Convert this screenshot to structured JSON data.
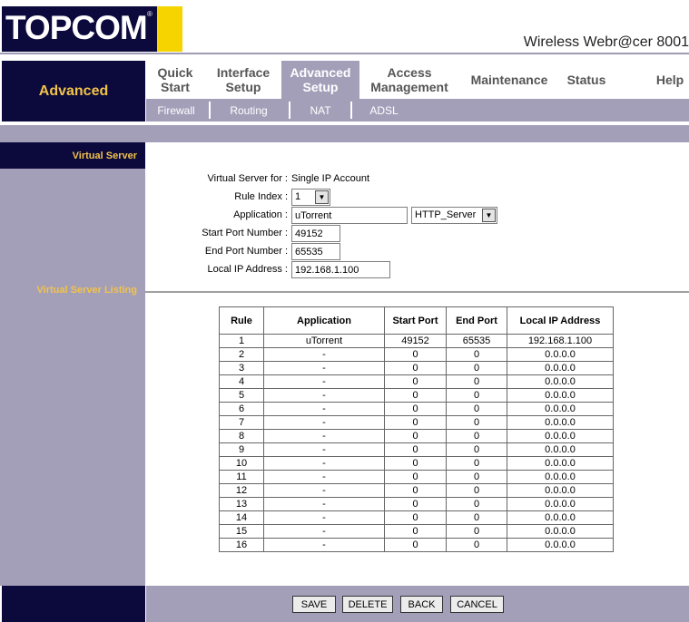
{
  "brand": {
    "logo_text": "TOPCOM",
    "reg_mark": "®",
    "product": "Wireless Webr@cer 8001"
  },
  "section": "Advanced",
  "nav": {
    "main": [
      {
        "label": "Quick Start"
      },
      {
        "label": "Interface Setup"
      },
      {
        "label": "Advanced Setup"
      },
      {
        "label": "Access Management"
      },
      {
        "label": "Maintenance"
      },
      {
        "label": "Status"
      },
      {
        "label": "Help"
      }
    ],
    "sub": [
      {
        "label": "Firewall"
      },
      {
        "label": "Routing"
      },
      {
        "label": "NAT"
      },
      {
        "label": "ADSL"
      }
    ]
  },
  "sidebar": {
    "virtual_server": "Virtual Server",
    "virtual_server_listing": "Virtual Server Listing"
  },
  "form": {
    "vs_for_label": "Virtual Server for :",
    "vs_for_value": "Single IP Account",
    "rule_index_label": "Rule Index :",
    "rule_index_value": "1",
    "application_label": "Application :",
    "application_value": "uTorrent",
    "application_select": "HTTP_Server",
    "start_port_label": "Start Port Number :",
    "start_port_value": "49152",
    "end_port_label": "End Port Number :",
    "end_port_value": "65535",
    "local_ip_label": "Local IP Address :",
    "local_ip_value": "192.168.1.100"
  },
  "table": {
    "headers": [
      "Rule",
      "Application",
      "Start Port",
      "End Port",
      "Local IP Address"
    ],
    "rows": [
      [
        "1",
        "uTorrent",
        "49152",
        "65535",
        "192.168.1.100"
      ],
      [
        "2",
        "-",
        "0",
        "0",
        "0.0.0.0"
      ],
      [
        "3",
        "-",
        "0",
        "0",
        "0.0.0.0"
      ],
      [
        "4",
        "-",
        "0",
        "0",
        "0.0.0.0"
      ],
      [
        "5",
        "-",
        "0",
        "0",
        "0.0.0.0"
      ],
      [
        "6",
        "-",
        "0",
        "0",
        "0.0.0.0"
      ],
      [
        "7",
        "-",
        "0",
        "0",
        "0.0.0.0"
      ],
      [
        "8",
        "-",
        "0",
        "0",
        "0.0.0.0"
      ],
      [
        "9",
        "-",
        "0",
        "0",
        "0.0.0.0"
      ],
      [
        "10",
        "-",
        "0",
        "0",
        "0.0.0.0"
      ],
      [
        "11",
        "-",
        "0",
        "0",
        "0.0.0.0"
      ],
      [
        "12",
        "-",
        "0",
        "0",
        "0.0.0.0"
      ],
      [
        "13",
        "-",
        "0",
        "0",
        "0.0.0.0"
      ],
      [
        "14",
        "-",
        "0",
        "0",
        "0.0.0.0"
      ],
      [
        "15",
        "-",
        "0",
        "0",
        "0.0.0.0"
      ],
      [
        "16",
        "-",
        "0",
        "0",
        "0.0.0.0"
      ]
    ]
  },
  "buttons": {
    "save": "SAVE",
    "delete": "DELETE",
    "back": "BACK",
    "cancel": "CANCEL"
  },
  "colors": {
    "navy": "#0c0a3c",
    "lavender": "#a49fb9",
    "gold": "#f2c34a",
    "logo_yellow": "#f5d400"
  }
}
